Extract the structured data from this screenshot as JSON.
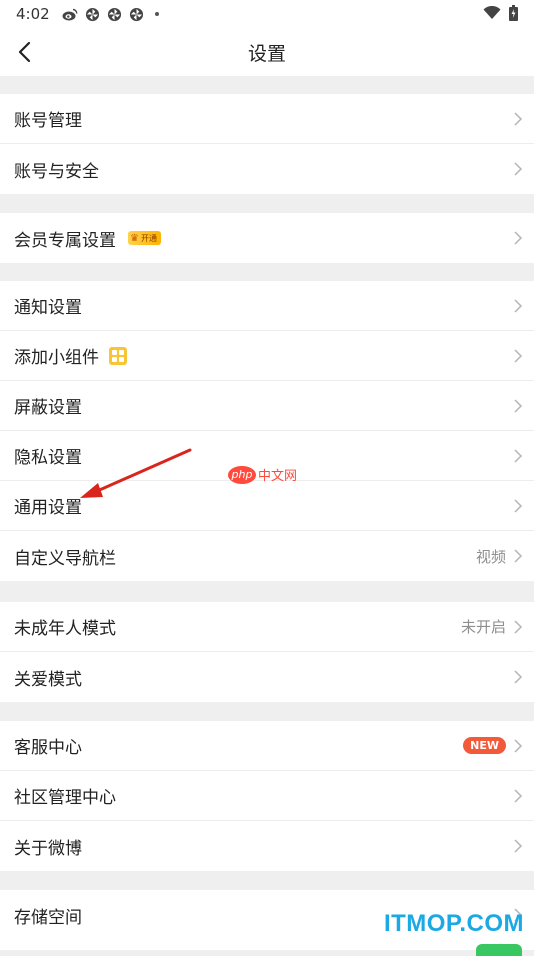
{
  "status_bar": {
    "time": "4:02",
    "icons": [
      "weibo-icon",
      "pinwheel-icon",
      "pinwheel-icon",
      "pinwheel-icon",
      "dot-icon"
    ],
    "right_icons": [
      "wifi-icon",
      "battery-icon"
    ]
  },
  "nav": {
    "back_icon": "chevron-left-icon",
    "title": "设置"
  },
  "groups": [
    {
      "items": [
        {
          "label": "账号管理",
          "value": ""
        },
        {
          "label": "账号与安全",
          "value": ""
        }
      ]
    },
    {
      "items": [
        {
          "label": "会员专属设置",
          "badge_text": "开通",
          "badge_color": "#ffc21a"
        }
      ]
    },
    {
      "items": [
        {
          "label": "通知设置",
          "value": ""
        },
        {
          "label": "添加小组件",
          "icon": "widget-grid-icon",
          "icon_color": "#f7c535"
        },
        {
          "label": "屏蔽设置",
          "value": ""
        },
        {
          "label": "隐私设置",
          "value": ""
        },
        {
          "label": "通用设置",
          "value": ""
        },
        {
          "label": "自定义导航栏",
          "value": "视频"
        }
      ]
    },
    {
      "items": [
        {
          "label": "未成年人模式",
          "value": "未开启"
        },
        {
          "label": "关爱模式",
          "value": ""
        }
      ]
    },
    {
      "items": [
        {
          "label": "客服中心",
          "badge": "NEW",
          "badge_color": "#f35a3a"
        },
        {
          "label": "社区管理中心",
          "value": ""
        },
        {
          "label": "关于微博",
          "value": ""
        }
      ]
    },
    {
      "items": [
        {
          "label": "存储空间",
          "value": ""
        }
      ]
    }
  ],
  "watermarks": {
    "php_logo": "php",
    "php_text": "中文网",
    "itmop": "ITMOP.COM"
  },
  "colors": {
    "background": "#efefef",
    "annotation_arrow": "#d9261c",
    "itmop_blue": "#1ba9e6",
    "toggle_green": "#38c760"
  }
}
